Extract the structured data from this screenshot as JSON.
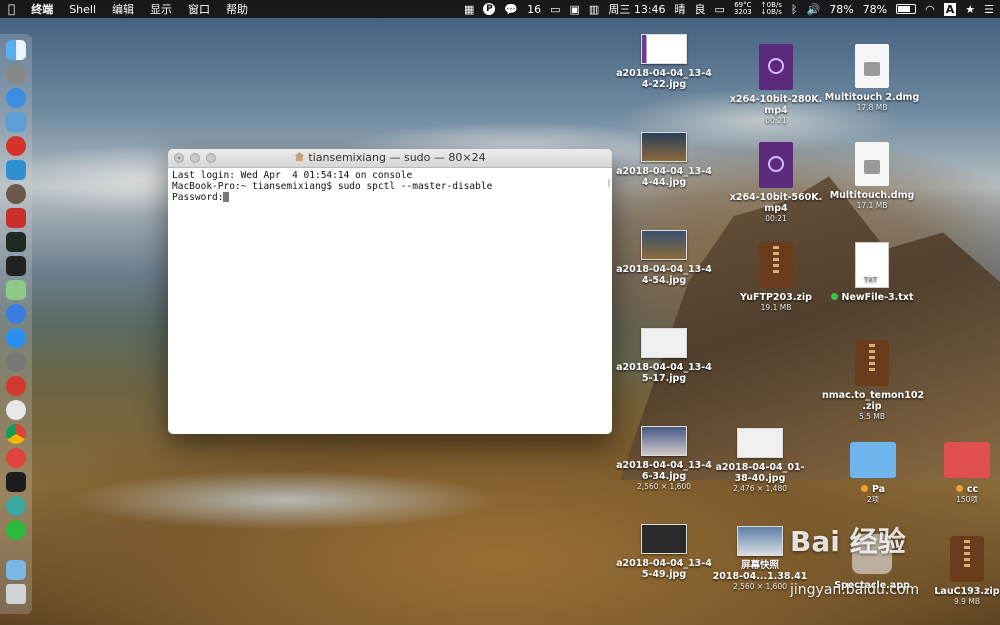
{
  "menubar": {
    "app_menus": [
      "终端",
      "Shell",
      "编辑",
      "显示",
      "窗口",
      "帮助"
    ],
    "status": {
      "wechat_count": "16",
      "temp": "69°C",
      "fan": "3203",
      "net_up": "↑0B/s",
      "net_down": "↓0B/s",
      "battery_1": "78%",
      "battery_2": "78%",
      "clock": "周三 13:46",
      "weather_1": "晴",
      "weather_2": "良",
      "input_method": "A"
    }
  },
  "terminal": {
    "title": "tiansemixiang — sudo — 80×24",
    "lines": [
      "Last login: Wed Apr  4 01:54:14 on console",
      "MacBook-Pro:~ tiansemixiang$ sudo spctl --master-disable",
      "Password:"
    ]
  },
  "desktop": {
    "icons": [
      {
        "label": "a2018-04-04_13-4\n4-22.jpg"
      },
      {
        "label": "a2018-04-04_13-4\n4-44.jpg"
      },
      {
        "label": "a2018-04-04_13-4\n4-54.jpg"
      },
      {
        "label": "a2018-04-04_13-4\n5-17.jpg"
      },
      {
        "label": "a2018-04-04_13-4\n6-34.jpg",
        "sub": "2,560 × 1,600"
      },
      {
        "label": "a2018-04-04_13-4\n5-49.jpg"
      },
      {
        "label": "x264-10bit-280K.\nmp4",
        "sub": "00:21"
      },
      {
        "label": "x264-10bit-560K.\nmp4",
        "sub": "00:21"
      },
      {
        "label": "YuFTP203.zip",
        "sub": "19.1 MB"
      },
      {
        "label": "a2018-04-04_01-\n38-40.jpg",
        "sub": "2,476 × 1,480"
      },
      {
        "label": "屏幕快照\n2018-04...1.38.41",
        "sub": "2,560 × 1,600"
      },
      {
        "label": "Multitouch 2.dmg",
        "sub": "17.8 MB"
      },
      {
        "label": "Multitouch.dmg",
        "sub": "17.1 MB"
      },
      {
        "label": "NewFile-3.txt"
      },
      {
        "label": "nmac.to_temon102\n.zip",
        "sub": "5.5 MB"
      },
      {
        "label": "Pa",
        "sub": "2项"
      },
      {
        "label": "Spectacle.app"
      },
      {
        "label": "cc",
        "sub": "150项"
      },
      {
        "label": "LauC193.zip",
        "sub": "9.9 MB"
      }
    ],
    "txt_badge": "TXT"
  },
  "watermark": {
    "text": "Bai 经验",
    "url": "jingyan.baidu.com"
  },
  "colors": {
    "menubar_bg": "#141414",
    "folder_blue": "#6fb6ee",
    "folder_red": "#e05050",
    "tag_orange": "#f0a030",
    "tag_green": "#3fc24a"
  }
}
